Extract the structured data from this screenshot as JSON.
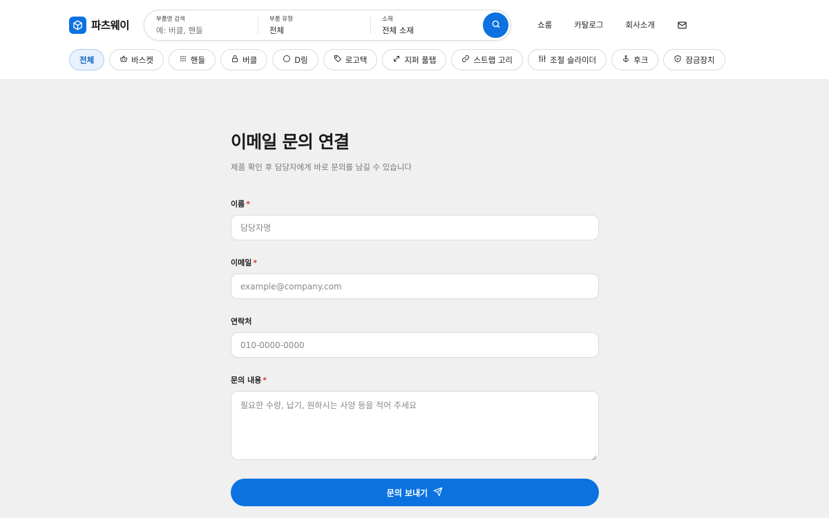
{
  "brand": {
    "name": "파츠웨이"
  },
  "search": {
    "name_label": "부품명 검색",
    "name_placeholder": "예: 버클, 핸들",
    "type_label": "부품 유형",
    "type_value": "전체",
    "material_label": "소재",
    "material_value": "전체 소재",
    "button_icon": "search-icon"
  },
  "nav": {
    "items": [
      "쇼룸",
      "카탈로그",
      "회사소개"
    ],
    "mail_icon": "mail-icon"
  },
  "categories": [
    {
      "label": "전체",
      "icon": "",
      "active": true
    },
    {
      "label": "바스켓",
      "icon": "basket-icon"
    },
    {
      "label": "핸들",
      "icon": "grip-icon"
    },
    {
      "label": "버클",
      "icon": "lock-icon"
    },
    {
      "label": "D링",
      "icon": "circle-icon"
    },
    {
      "label": "로고택",
      "icon": "tag-icon"
    },
    {
      "label": "지퍼 풀탭",
      "icon": "expand-icon"
    },
    {
      "label": "스트랩 고리",
      "icon": "link-icon"
    },
    {
      "label": "조절 슬라이더",
      "icon": "sliders-icon"
    },
    {
      "label": "후크",
      "icon": "anchor-icon"
    },
    {
      "label": "잠금장치",
      "icon": "shield-icon"
    }
  ],
  "form": {
    "title": "이메일 문의 연결",
    "subtitle": "제품 확인 후 담당자에게 바로 문의를 남길 수 있습니다",
    "required_mark": "*",
    "name_label": "이름",
    "name_placeholder": "담당자명",
    "email_label": "이메일",
    "email_placeholder": "example@company.com",
    "phone_label": "연락처",
    "phone_placeholder": "010-0000-0000",
    "message_label": "문의 내용",
    "message_placeholder": "필요한 수량, 납기, 원하시는 사양 등을 적어 주세요",
    "submit_label": "문의 보내기",
    "submit_icon": "send-icon"
  },
  "colors": {
    "accent": "#0b72e0",
    "required": "#dd3333",
    "background": "#f0f0f0"
  }
}
